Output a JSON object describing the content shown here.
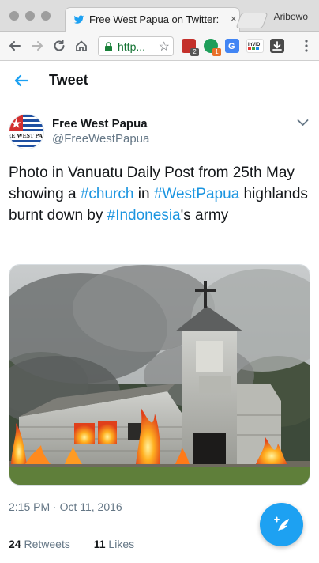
{
  "browser": {
    "tab_title": "Free West Papua on Twitter:",
    "tab_close": "×",
    "profile_name": "Aribowo",
    "url": "http...",
    "extensions": [
      {
        "name": "ublock-origin",
        "badge": "2",
        "color": "#c4302b"
      },
      {
        "name": "ghostery",
        "badge": "1",
        "color": "#1e9e5a"
      },
      {
        "name": "google-translate",
        "badge": "",
        "color": "#4285f4"
      },
      {
        "name": "invid",
        "label": "InVID",
        "color": "#ffffff"
      },
      {
        "name": "download",
        "badge": "",
        "color": "#444444"
      }
    ]
  },
  "header": {
    "title": "Tweet"
  },
  "tweet": {
    "avatar_text": "FREE WEST PAPUA",
    "display_name": "Free West Papua",
    "handle": "@FreeWestPapua",
    "text_parts": [
      "Photo in Vanuatu Daily Post from 25th May showing a ",
      "#church",
      " in ",
      "#WestPapua",
      " highlands burnt down by ",
      "#Indonesia",
      "'s army"
    ],
    "timestamp": "2:15 PM · Oct 11, 2016",
    "retweets": "24",
    "retweets_label": "Retweets",
    "likes": "11",
    "likes_label": "Likes"
  },
  "colors": {
    "accent": "#1da1f2",
    "hashtag": "#1b95e0",
    "text_primary": "#14171a",
    "text_secondary": "#657786"
  },
  "icons": {
    "back": "arrow-left-icon",
    "caret": "chevron-down-icon",
    "fab": "compose-tweet-icon"
  }
}
